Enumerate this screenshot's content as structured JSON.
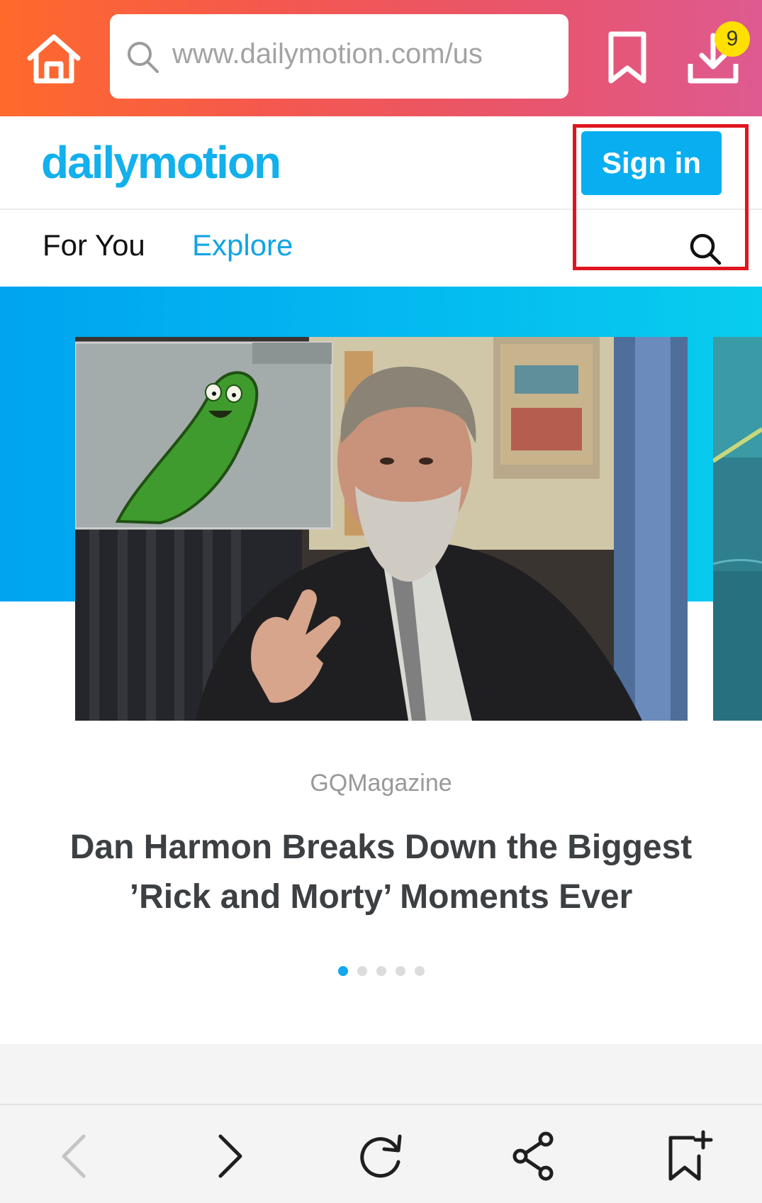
{
  "browser": {
    "url": "www.dailymotion.com/us",
    "download_count": "9",
    "icons": {
      "home": "home-icon",
      "search": "search-icon",
      "bookmark": "bookmark-icon",
      "download": "download-icon"
    }
  },
  "site": {
    "logo": "dailymotion",
    "sign_in_label": "Sign in"
  },
  "nav": {
    "tabs": [
      {
        "label": "For You",
        "active": false
      },
      {
        "label": "Explore",
        "active": true
      }
    ]
  },
  "carousel": {
    "slides_total": 5,
    "active_slide": 1,
    "current": {
      "channel": "GQMagazine",
      "title": "Dan Harmon Breaks Down the Biggest ’Rick and Morty’ Moments Ever"
    }
  },
  "toolbar": {
    "buttons": [
      "back-icon",
      "forward-icon",
      "reload-icon",
      "share-icon",
      "add-bookmark-icon"
    ]
  },
  "colors": {
    "brand_blue": "#12b0ec",
    "sign_in_bg": "#08aef0",
    "highlight": "#e0161e",
    "badge": "#ffe000",
    "browser_gradient_start": "#ff6a2b",
    "browser_gradient_end": "#de5a90"
  }
}
